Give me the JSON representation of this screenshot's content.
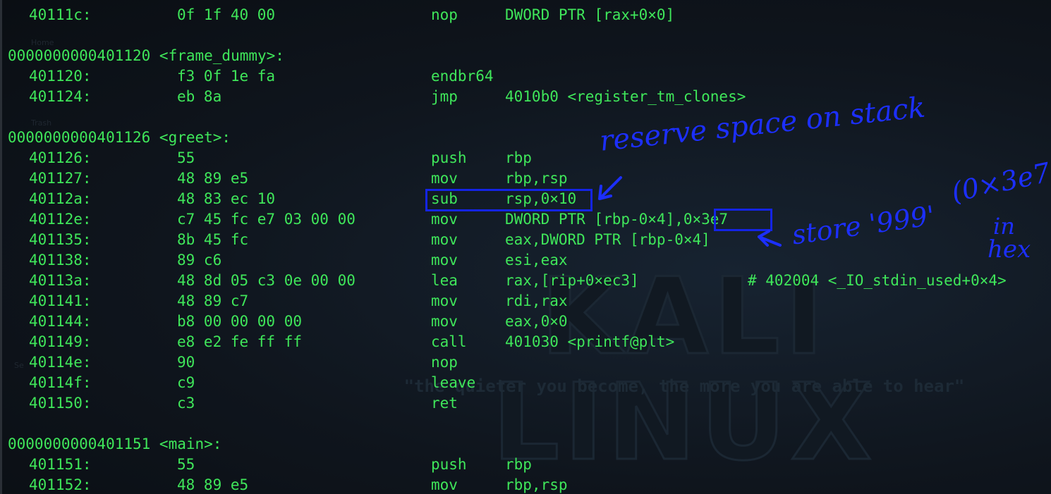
{
  "wallpaper": {
    "logo": "KALI LINUX",
    "tagline": "\"the quieter you become, the more you are able to hear\"",
    "desktop_labels": [
      "Home",
      "Trash",
      "Se"
    ]
  },
  "lines": [
    {
      "kind": "ins",
      "addr": "40111c:",
      "bytes": "0f 1f 40 00",
      "mnem": "nop",
      "ops": "DWORD PTR [rax+0×0]"
    },
    {
      "kind": "blank"
    },
    {
      "kind": "label",
      "text": "0000000000401120 <frame_dummy>:"
    },
    {
      "kind": "ins",
      "addr": "401120:",
      "bytes": "f3 0f 1e fa",
      "mnem": "endbr64",
      "ops": ""
    },
    {
      "kind": "ins",
      "addr": "401124:",
      "bytes": "eb 8a",
      "mnem": "jmp",
      "ops": "4010b0 <register_tm_clones>"
    },
    {
      "kind": "blank"
    },
    {
      "kind": "label",
      "text": "0000000000401126 <greet>:"
    },
    {
      "kind": "ins",
      "addr": "401126:",
      "bytes": "55",
      "mnem": "push",
      "ops": "rbp"
    },
    {
      "kind": "ins",
      "addr": "401127:",
      "bytes": "48 89 e5",
      "mnem": "mov",
      "ops": "rbp,rsp"
    },
    {
      "kind": "ins",
      "addr": "40112a:",
      "bytes": "48 83 ec 10",
      "mnem": "sub",
      "ops": "rsp,0×10"
    },
    {
      "kind": "ins",
      "addr": "40112e:",
      "bytes": "c7 45 fc e7 03 00 00",
      "mnem": "mov",
      "ops": "DWORD PTR [rbp-0×4],0×3e7"
    },
    {
      "kind": "ins",
      "addr": "401135:",
      "bytes": "8b 45 fc",
      "mnem": "mov",
      "ops": "eax,DWORD PTR [rbp-0×4]"
    },
    {
      "kind": "ins",
      "addr": "401138:",
      "bytes": "89 c6",
      "mnem": "mov",
      "ops": "esi,eax"
    },
    {
      "kind": "ins",
      "addr": "40113a:",
      "bytes": "48 8d 05 c3 0e 00 00",
      "mnem": "lea",
      "ops": "rax,[rip+0×ec3]",
      "comment": "# 402004 <_IO_stdin_used+0×4>"
    },
    {
      "kind": "ins",
      "addr": "401141:",
      "bytes": "48 89 c7",
      "mnem": "mov",
      "ops": "rdi,rax"
    },
    {
      "kind": "ins",
      "addr": "401144:",
      "bytes": "b8 00 00 00 00",
      "mnem": "mov",
      "ops": "eax,0×0"
    },
    {
      "kind": "ins",
      "addr": "401149:",
      "bytes": "e8 e2 fe ff ff",
      "mnem": "call",
      "ops": "401030 <printf@plt>"
    },
    {
      "kind": "ins",
      "addr": "40114e:",
      "bytes": "90",
      "mnem": "nop",
      "ops": ""
    },
    {
      "kind": "ins",
      "addr": "40114f:",
      "bytes": "c9",
      "mnem": "leave",
      "ops": ""
    },
    {
      "kind": "ins",
      "addr": "401150:",
      "bytes": "c3",
      "mnem": "ret",
      "ops": ""
    },
    {
      "kind": "blank"
    },
    {
      "kind": "label",
      "text": "0000000000401151 <main>:"
    },
    {
      "kind": "ins",
      "addr": "401151:",
      "bytes": "55",
      "mnem": "push",
      "ops": "rbp"
    },
    {
      "kind": "ins",
      "addr": "401152:",
      "bytes": "48 89 e5",
      "mnem": "mov",
      "ops": "rbp,rsp"
    }
  ],
  "annotations": {
    "reserve": "reserve space on stack",
    "store": "store '999'",
    "hex_line1": "(0×3e7)",
    "hex_line2": "in",
    "hex_line3": "hex"
  },
  "colors": {
    "code_text": "#3fe65a",
    "annotation_ink": "#1c2fff",
    "background": "#0d1117"
  }
}
